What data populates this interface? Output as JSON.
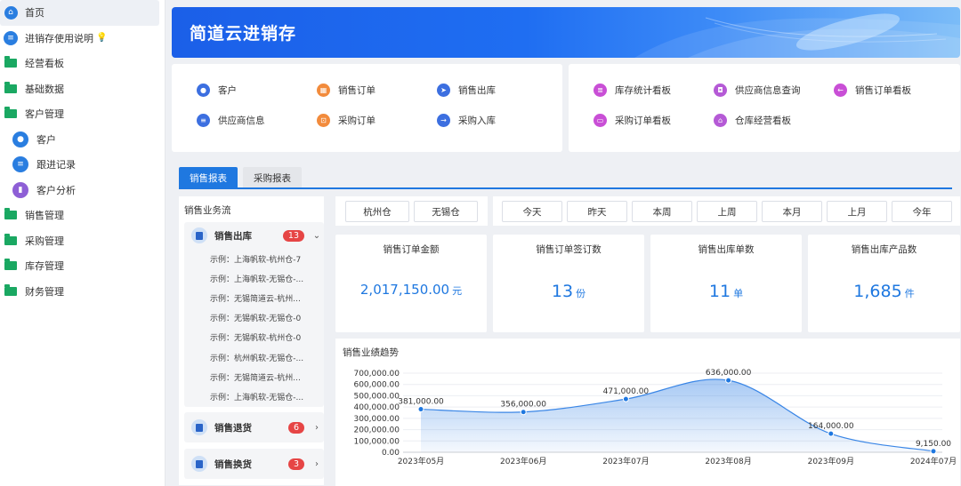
{
  "sidebar": {
    "items": [
      {
        "label": "首页",
        "icon": "home-icon"
      },
      {
        "label": "进销存使用说明",
        "icon": "doc-icon"
      },
      {
        "label": "经营看板",
        "icon": "folder-icon"
      },
      {
        "label": "基础数据",
        "icon": "folder-icon"
      },
      {
        "label": "客户管理",
        "icon": "folder-icon"
      },
      {
        "label": "客户",
        "icon": "user-icon"
      },
      {
        "label": "跟进记录",
        "icon": "doc-icon"
      },
      {
        "label": "客户分析",
        "icon": "bar-chart-icon"
      },
      {
        "label": "销售管理",
        "icon": "folder-icon"
      },
      {
        "label": "采购管理",
        "icon": "folder-icon"
      },
      {
        "label": "库存管理",
        "icon": "folder-icon"
      },
      {
        "label": "财务管理",
        "icon": "folder-icon"
      }
    ]
  },
  "banner": {
    "title": "简道云进销存"
  },
  "shortcuts_left": [
    {
      "label": "客户"
    },
    {
      "label": "销售订单"
    },
    {
      "label": "销售出库"
    },
    {
      "label": "供应商信息"
    },
    {
      "label": "采购订单"
    },
    {
      "label": "采购入库"
    }
  ],
  "shortcuts_right": [
    {
      "label": "库存统计看板"
    },
    {
      "label": "供应商信息查询"
    },
    {
      "label": "销售订单看板"
    },
    {
      "label": "采购订单看板"
    },
    {
      "label": "仓库经营看板"
    }
  ],
  "report": {
    "tabs": [
      "销售报表",
      "采购报表"
    ],
    "flow_title": "销售业务流",
    "groups": [
      {
        "label": "销售出库",
        "count": "13",
        "items": [
          "示例：上海帆软-杭州仓-7",
          "示例：上海帆软-无锡仓-...",
          "示例：无锡简道云-杭州...",
          "示例：无锡帆软-无锡仓-0",
          "示例：无锡帆软-杭州仓-0",
          "示例：杭州帆软-无锡仓-...",
          "示例：无锡简道云-杭州...",
          "示例：上海帆软-无锡仓-..."
        ]
      },
      {
        "label": "销售退货",
        "count": "6"
      },
      {
        "label": "销售换货",
        "count": "3"
      }
    ],
    "warehouses": [
      "杭州仓",
      "无锡仓"
    ],
    "periods": [
      "今天",
      "昨天",
      "本周",
      "上周",
      "本月",
      "上月",
      "今年"
    ],
    "kpis": [
      {
        "label": "销售订单金额",
        "value": "2,017,150.00",
        "unit": "元"
      },
      {
        "label": "销售订单签订数",
        "value": "13",
        "unit": "份"
      },
      {
        "label": "销售出库单数",
        "value": "11",
        "unit": "单"
      },
      {
        "label": "销售出库产品数",
        "value": "1,685",
        "unit": "件"
      }
    ]
  },
  "colors": {
    "accent": "#1f78e0",
    "line": "#3a86e6",
    "badge": "#e64545"
  },
  "chart_data": {
    "type": "area",
    "title": "销售业绩趋势",
    "categories": [
      "2023年05月",
      "2023年06月",
      "2023年07月",
      "2023年08月",
      "2023年09月",
      "2024年07月"
    ],
    "values": [
      381000,
      356000,
      471000,
      636000,
      164000,
      9150
    ],
    "value_labels": [
      "381,000.00",
      "356,000.00",
      "471,000.00",
      "636,000.00",
      "164,000.00",
      "9,150.00"
    ],
    "ylim": [
      0,
      700000
    ],
    "yticks": [
      "0.00",
      "100,000.00",
      "200,000.00",
      "300,000.00",
      "400,000.00",
      "500,000.00",
      "600,000.00",
      "700,000.00"
    ],
    "grid": true
  }
}
